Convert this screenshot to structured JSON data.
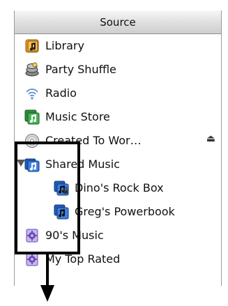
{
  "header": {
    "title": "Source"
  },
  "items": [
    {
      "label": "Library",
      "icon": "library-icon"
    },
    {
      "label": "Party Shuffle",
      "icon": "party-shuffle-icon"
    },
    {
      "label": "Radio",
      "icon": "radio-icon"
    },
    {
      "label": "Music Store",
      "icon": "music-store-icon"
    },
    {
      "label": "Created To Wor…",
      "icon": "cd-icon",
      "eject": "⏏"
    },
    {
      "label": "Shared Music",
      "icon": "shared-music-icon",
      "expanded": true
    },
    {
      "label": "Dino's Rock Box",
      "icon": "shared-library-icon",
      "indent": 1
    },
    {
      "label": "Greg's Powerbook",
      "icon": "shared-library-icon",
      "indent": 1
    },
    {
      "label": "90's Music",
      "icon": "smart-playlist-icon"
    },
    {
      "label": "My Top Rated",
      "icon": "smart-playlist-icon"
    }
  ],
  "colors": {
    "library_orange": "#e69a1b",
    "store_green": "#3aa54a",
    "shared_blue": "#2f6fd6",
    "smart_purple": "#8e6ad8"
  }
}
